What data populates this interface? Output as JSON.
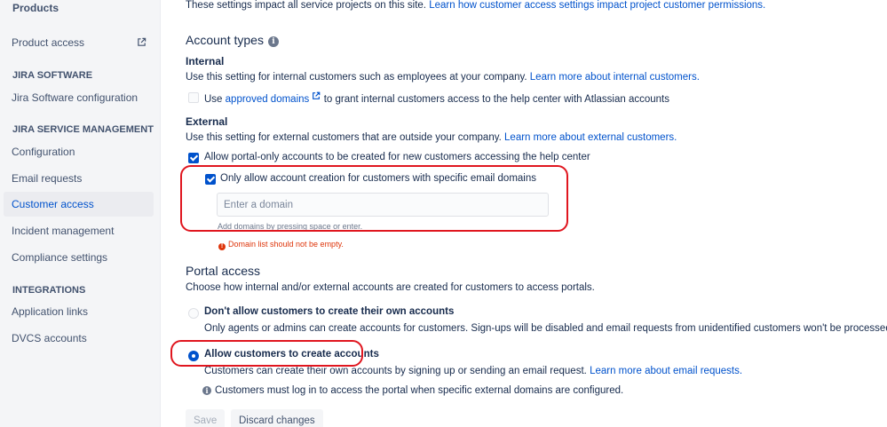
{
  "sidebar": {
    "top_label": "Products",
    "product_access": "Product access",
    "section_jira_software": "JIRA SOFTWARE",
    "jira_software_configuration": "Jira Software configuration",
    "section_jsm": "JIRA SERVICE MANAGEMENT",
    "configuration": "Configuration",
    "email_requests": "Email requests",
    "customer_access": "Customer access",
    "incident_management": "Incident management",
    "compliance_settings": "Compliance settings",
    "section_integrations": "INTEGRATIONS",
    "application_links": "Application links",
    "dvcs_accounts": "DVCS accounts"
  },
  "intro": {
    "text": "These settings impact all service projects on this site.",
    "link": "Learn how customer access settings impact project customer permissions."
  },
  "account_types": {
    "title": "Account types",
    "internal": {
      "title": "Internal",
      "desc": "Use this setting for internal customers such as employees at your company.",
      "link": "Learn more about internal customers.",
      "checkbox_prefix": "Use",
      "checkbox_link": "approved domains",
      "checkbox_suffix": "to grant internal customers access to the help center with Atlassian accounts",
      "checked": false
    },
    "external": {
      "title": "External",
      "desc": "Use this setting for external customers that are outside your company.",
      "link": "Learn more about external customers.",
      "portal_only_label": "Allow portal-only accounts to be created for new customers accessing the help center",
      "portal_only_checked": true,
      "specific_domains_label": "Only allow account creation for customers with specific email domains",
      "specific_domains_checked": true,
      "domain_placeholder": "Enter a domain",
      "domain_value": "",
      "helper": "Add domains by pressing space or enter.",
      "error": "Domain list should not be empty."
    }
  },
  "portal_access": {
    "title": "Portal access",
    "desc": "Choose how internal and/or external accounts are created for customers to access portals.",
    "option_disallow": {
      "label": "Don't allow customers to create their own accounts",
      "desc": "Only agents or admins can create accounts for customers. Sign-ups will be disabled and email requests from unidentified customers won't be processed.",
      "selected": false
    },
    "option_allow": {
      "label": "Allow customers to create accounts",
      "desc": "Customers can create their own accounts by signing up or sending an email request.",
      "link": "Learn more about email requests.",
      "selected": true
    },
    "note": "Customers must log in to access the portal when specific external domains are configured."
  },
  "actions": {
    "save": "Save",
    "discard": "Discard changes"
  },
  "colors": {
    "link": "#0052cc",
    "annotation_red": "#e0161f",
    "error": "#de350b",
    "sidebar_bg": "#f4f5f7"
  }
}
